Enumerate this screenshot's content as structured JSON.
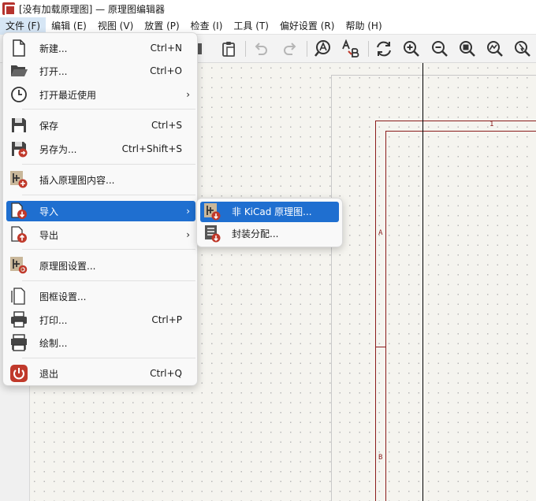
{
  "window": {
    "title": "[没有加载原理图] — 原理图编辑器"
  },
  "menubar": [
    "文件 (F)",
    "编辑 (E)",
    "视图 (V)",
    "放置 (P)",
    "检查 (I)",
    "工具 (T)",
    "偏好设置 (R)",
    "帮助 (H)"
  ],
  "file_menu": {
    "new": {
      "label": "新建...",
      "shortcut": "Ctrl+N"
    },
    "open": {
      "label": "打开...",
      "shortcut": "Ctrl+O"
    },
    "open_recent": {
      "label": "打开最近使用"
    },
    "save": {
      "label": "保存",
      "shortcut": "Ctrl+S"
    },
    "save_as": {
      "label": "另存为...",
      "shortcut": "Ctrl+Shift+S"
    },
    "insert": {
      "label": "插入原理图内容..."
    },
    "import": {
      "label": "导入"
    },
    "export": {
      "label": "导出"
    },
    "schematic_setup": {
      "label": "原理图设置..."
    },
    "page_settings": {
      "label": "图框设置..."
    },
    "print": {
      "label": "打印...",
      "shortcut": "Ctrl+P"
    },
    "plot": {
      "label": "绘制..."
    },
    "quit": {
      "label": "退出",
      "shortcut": "Ctrl+Q"
    }
  },
  "import_submenu": {
    "non_kicad": {
      "label": "非 KiCad 原理图..."
    },
    "footprint_assign": {
      "label": "封装分配..."
    }
  },
  "frame_labels": {
    "top_1": "1",
    "side_a": "A",
    "side_b": "B"
  },
  "colors": {
    "highlight": "#1f6fd0",
    "frame": "#8a1c1c"
  }
}
